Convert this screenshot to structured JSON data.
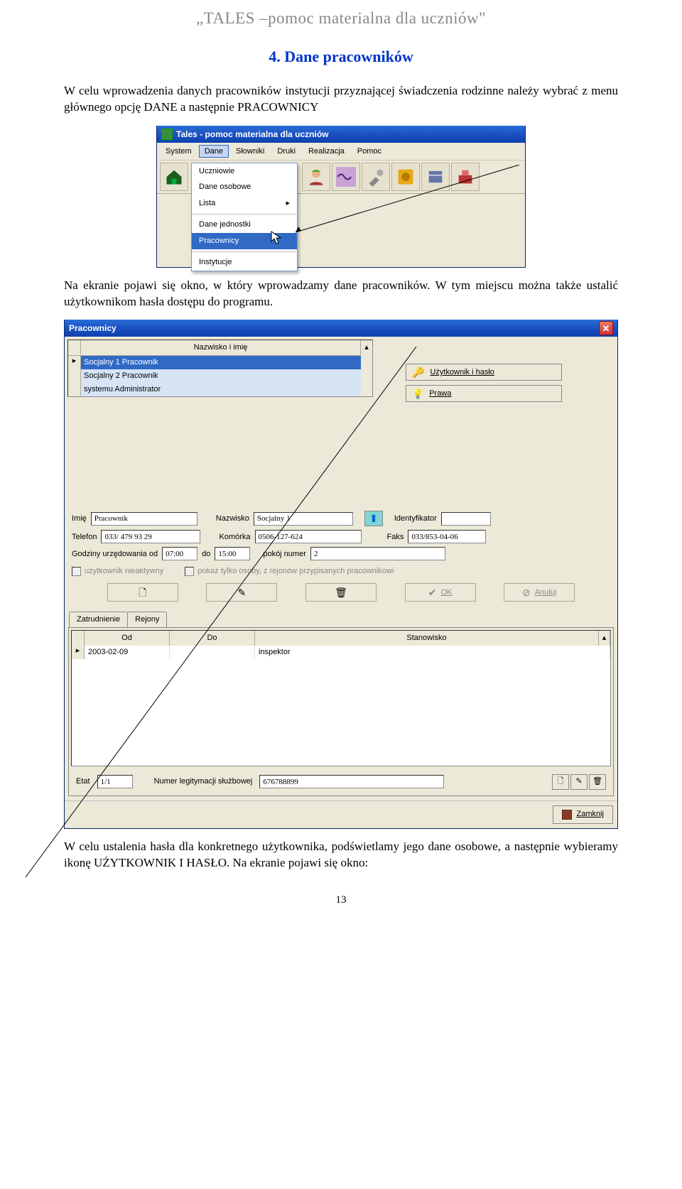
{
  "doc": {
    "header": "„TALES –pomoc materialna dla uczniów\"",
    "section": "4. Dane pracowników",
    "para1": "W celu wprowadzenia danych pracowników instytucji przyznającej świadczenia rodzinne należy wybrać z menu głównego opcję DANE a następnie PRACOWNICY",
    "para2": "Na ekranie pojawi się okno, w który wprowadzamy dane pracowników. W tym miejscu można także ustalić użytkownikom hasła dostępu do programu.",
    "para3": "W celu ustalenia hasła dla konkretnego użytkownika, podświetlamy jego dane osobowe, a następnie wybieramy ikonę UŻYTKOWNIK I HASŁO. Na ekranie pojawi się okno:",
    "page_num": "13"
  },
  "scr1": {
    "title": "Tales - pomoc materialna dla uczniów",
    "menu": [
      "System",
      "Dane",
      "Słowniki",
      "Druki",
      "Realizacja",
      "Pomoc"
    ],
    "dropdown": {
      "items": [
        "Uczniowie",
        "Dane osobowe",
        "Lista"
      ],
      "items2": [
        "Dane jednostki",
        "Pracownicy",
        "Instytucje"
      ],
      "selected": "Pracownicy"
    }
  },
  "scr2": {
    "title": "Pracownicy",
    "list": {
      "header": "Nazwisko i imię",
      "rows": [
        "Socjalny 1 Pracownik",
        "Socjalny 2 Pracownik",
        "systemu Administrator"
      ]
    },
    "sidebtn1": "Użytkownik i hasło",
    "sidebtn2": "Prawa",
    "labels": {
      "imie": "Imię",
      "imie_v": "Pracownik",
      "nazwisko": "Nazwisko",
      "nazwisko_v": "Socjalny 1",
      "ident": "Identyfikator",
      "telefon": "Telefon",
      "telefon_v": "033/ 479 93 29",
      "komorka": "Komórka",
      "komorka_v": "0506-127-624",
      "faks": "Faks",
      "faks_v": "033/853-04-06",
      "godz": "Godziny urzędowania od",
      "godz_od": "07:00",
      "do": "do",
      "godz_do": "15:00",
      "pokoj": "pokój numer",
      "pokoj_v": "2",
      "chk1": "użytkownik nieaktywny",
      "chk2": "pokaż tylko osoby, z rejonów przypisanych pracownikowi",
      "ok": "OK",
      "anuluj": "Anuluj"
    },
    "tabs": [
      "Zatrudnienie",
      "Rejony"
    ],
    "grid": {
      "cols": [
        "Od",
        "Do",
        "Stanowisko"
      ],
      "row": {
        "od": "2003-02-09",
        "do": "",
        "stan": "inspektor"
      }
    },
    "bottom": {
      "etat": "Etat",
      "etat_v": "1/1",
      "legit": "Numer legitymacji służbowej",
      "legit_v": "676788899"
    },
    "close": "Zamknij"
  }
}
